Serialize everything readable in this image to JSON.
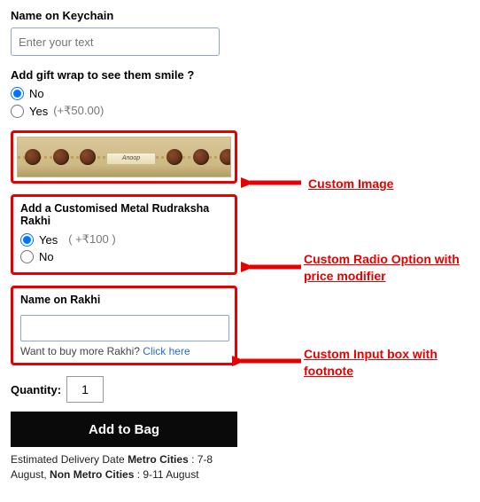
{
  "keychain": {
    "label": "Name on Keychain",
    "placeholder": "Enter your text"
  },
  "giftwrap": {
    "question": "Add gift wrap to see them smile ?",
    "no_label": "No",
    "yes_label": "Yes",
    "yes_suffix": "(+₹50.00)"
  },
  "product_plate_text": "Anoop",
  "custom_rakhi": {
    "question": "Add a Customised Metal Rudraksha Rakhi",
    "yes_label": "Yes",
    "yes_price": "( +₹100 )",
    "no_label": "No"
  },
  "name_on_rakhi": {
    "label": "Name on Rakhi",
    "footnote_text": "Want to buy more Rakhi?",
    "footnote_link": "Click here"
  },
  "quantity_label": "Quantity:",
  "quantity_value": "1",
  "add_button": "Add to Bag",
  "delivery": {
    "prefix": "Estimated Delivery Date",
    "metro_label": "Metro Cities",
    "metro_dates": "7-8 August,",
    "nonmetro_label": "Non Metro Cities",
    "nonmetro_dates": "9-11 August"
  },
  "annotations": {
    "image": "Custom Image",
    "radio": "Custom Radio Option with price modifier",
    "input": "Custom Input box with footnote"
  }
}
